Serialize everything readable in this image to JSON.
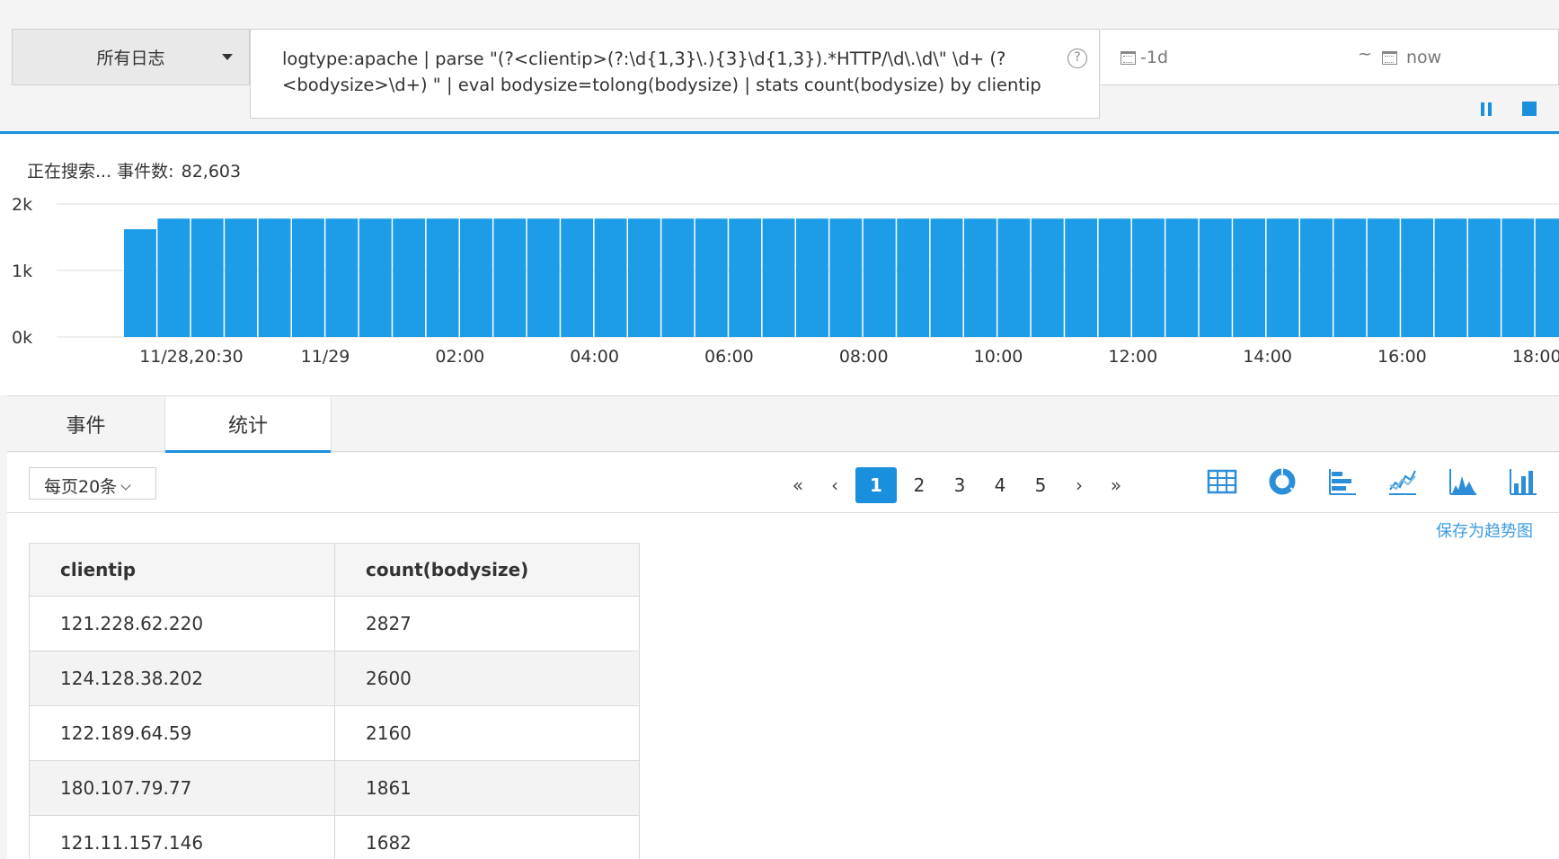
{
  "search": {
    "log_selector_label": "所有日志",
    "query": "logtype:apache | parse \"(?<clientip>(?:\\d{1,3}\\.){3}\\d{1,3}).*HTTP/\\d\\.\\d\\\" \\d+ (?\n<bodysize>\\d+) \" | eval bodysize=tolong(bodysize) | stats count(bodysize) by clientip",
    "help_label": "?",
    "time_from": "-1d",
    "time_separator": "~",
    "time_to": "now"
  },
  "status": {
    "searching_text": "正在搜索... 事件数:",
    "event_count": "82,603"
  },
  "colors": {
    "accent": "#1a8fde",
    "bar": "#1d9ce8"
  },
  "chart_data": {
    "type": "bar",
    "y_ticks": [
      "2k",
      "1k",
      "0k"
    ],
    "ylim": [
      0,
      2000
    ],
    "x_tick_labels": [
      "11/28,20:30",
      "11/29",
      "02:00",
      "04:00",
      "06:00",
      "08:00",
      "10:00",
      "12:00",
      "14:00",
      "16:00",
      "18:00"
    ],
    "values": [
      1620,
      1780,
      1780,
      1780,
      1780,
      1780,
      1780,
      1780,
      1780,
      1780,
      1780,
      1780,
      1780,
      1780,
      1780,
      1780,
      1780,
      1780,
      1780,
      1780,
      1780,
      1780,
      1780,
      1780,
      1780,
      1780,
      1780,
      1780,
      1780,
      1780,
      1780,
      1780,
      1780,
      1780,
      1780,
      1780,
      1780,
      1780,
      1780,
      1780,
      1780,
      1780,
      1780
    ],
    "grid": true
  },
  "tabs": [
    {
      "label": "事件",
      "active": false
    },
    {
      "label": "统计",
      "active": true
    }
  ],
  "results": {
    "per_page_label": "每页20条",
    "pager": {
      "first": "«",
      "prev": "‹",
      "pages": [
        "1",
        "2",
        "3",
        "4",
        "5"
      ],
      "current": "1",
      "next": "›",
      "last": "»"
    },
    "viz_icons": [
      "table-icon",
      "donut-chart-icon",
      "horizontal-bar-icon",
      "line-chart-icon",
      "area-chart-icon",
      "column-chart-icon"
    ],
    "save_trend_label": "保存为趋势图",
    "table": {
      "columns": [
        "clientip",
        "count(bodysize)"
      ],
      "rows": [
        [
          "121.228.62.220",
          "2827"
        ],
        [
          "124.128.38.202",
          "2600"
        ],
        [
          "122.189.64.59",
          "2160"
        ],
        [
          "180.107.79.77",
          "1861"
        ],
        [
          "121.11.157.146",
          "1682"
        ]
      ]
    }
  }
}
